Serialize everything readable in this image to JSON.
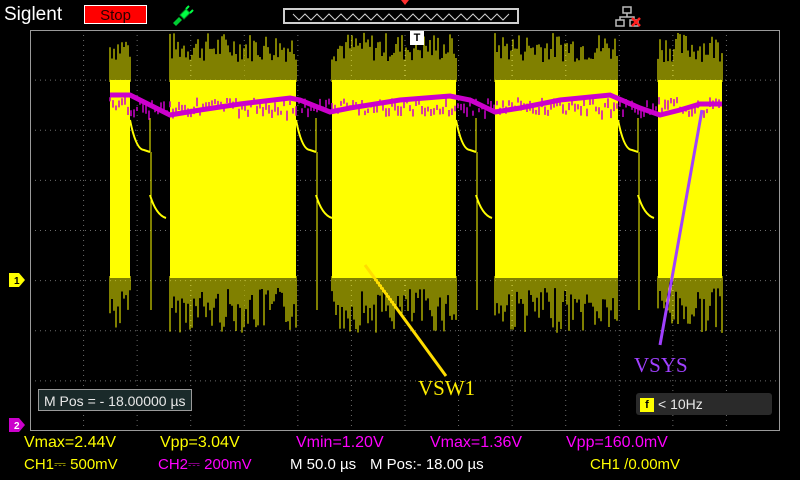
{
  "header": {
    "brand": "Siglent",
    "run_state": "Stop"
  },
  "screen": {
    "trigger_marker": "T",
    "ch1_marker": "1",
    "ch2_marker": "2",
    "mpos_box": "M Pos = - 18.00000 µs",
    "trigger_freq": "< 10Hz",
    "trigger_freq_icon": "f",
    "annotations": {
      "vsw1": "VSW1",
      "vsys": "VSYS"
    }
  },
  "measurements": {
    "ch1_vmax": "Vmax=2.44V",
    "ch1_vpp": "Vpp=3.04V",
    "ch2_vmin": "Vmin=1.20V",
    "ch2_vmax": "Vmax=1.36V",
    "ch2_vpp": "Vpp=160.0mV"
  },
  "status": {
    "ch1_scale": "CH1⎓ 500mV",
    "ch2_scale": "CH2⎓ 200mV",
    "timebase": "M 50.0 µs",
    "mpos": "M Pos:- 18.00 µs",
    "trigger": "CH1 /0.00mV"
  },
  "colors": {
    "ch1": "#ffff00",
    "ch2": "#cc00cc",
    "grid": "#9a9a9a",
    "stop": "#ff0000",
    "vsys_annotation": "#a040ff"
  }
}
